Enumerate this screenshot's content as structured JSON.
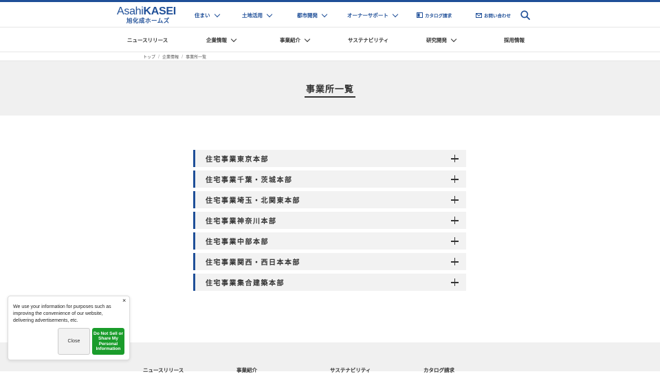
{
  "brand": {
    "name_en_light": "Asahi",
    "name_en_bold": "KASEI",
    "name_ja": "旭化成ホームズ",
    "accent": "#1f4f98"
  },
  "nav_primary": [
    {
      "label": "住まい"
    },
    {
      "label": "土地活用"
    },
    {
      "label": "都市開発"
    },
    {
      "label": "オーナーサポート"
    }
  ],
  "utility": {
    "catalog": "カタログ請求",
    "contact": "お問い合わせ",
    "search_icon": "search-icon"
  },
  "nav_secondary": [
    {
      "label": "ニュースリリース"
    },
    {
      "label": "企業情報"
    },
    {
      "label": "事業紹介"
    },
    {
      "label": "サステナビリティ"
    },
    {
      "label": "研究開発"
    },
    {
      "label": "採用情報"
    }
  ],
  "breadcrumb": [
    "トップ",
    "企業情報",
    "事業所一覧"
  ],
  "page_title": "事業所一覧",
  "offices": [
    "住宅事業東京本部",
    "住宅事業千葉・茨城本部",
    "住宅事業埼玉・北関東本部",
    "住宅事業神奈川本部",
    "住宅事業中部本部",
    "住宅事業関西・西日本本部",
    "住宅事業集合建築本部"
  ],
  "footer_links": [
    "ニュースリリース",
    "事業紹介",
    "サステナビリティ",
    "カタログ請求"
  ],
  "consent": {
    "text": "We use your information for purposes such as improving the convenience of our website, delivering advertisements, etc.",
    "close_x": "×",
    "close_label": "Close",
    "dns_label": "Do Not Sell or Share My Personal Information",
    "dns_color": "#1a9c2b"
  }
}
